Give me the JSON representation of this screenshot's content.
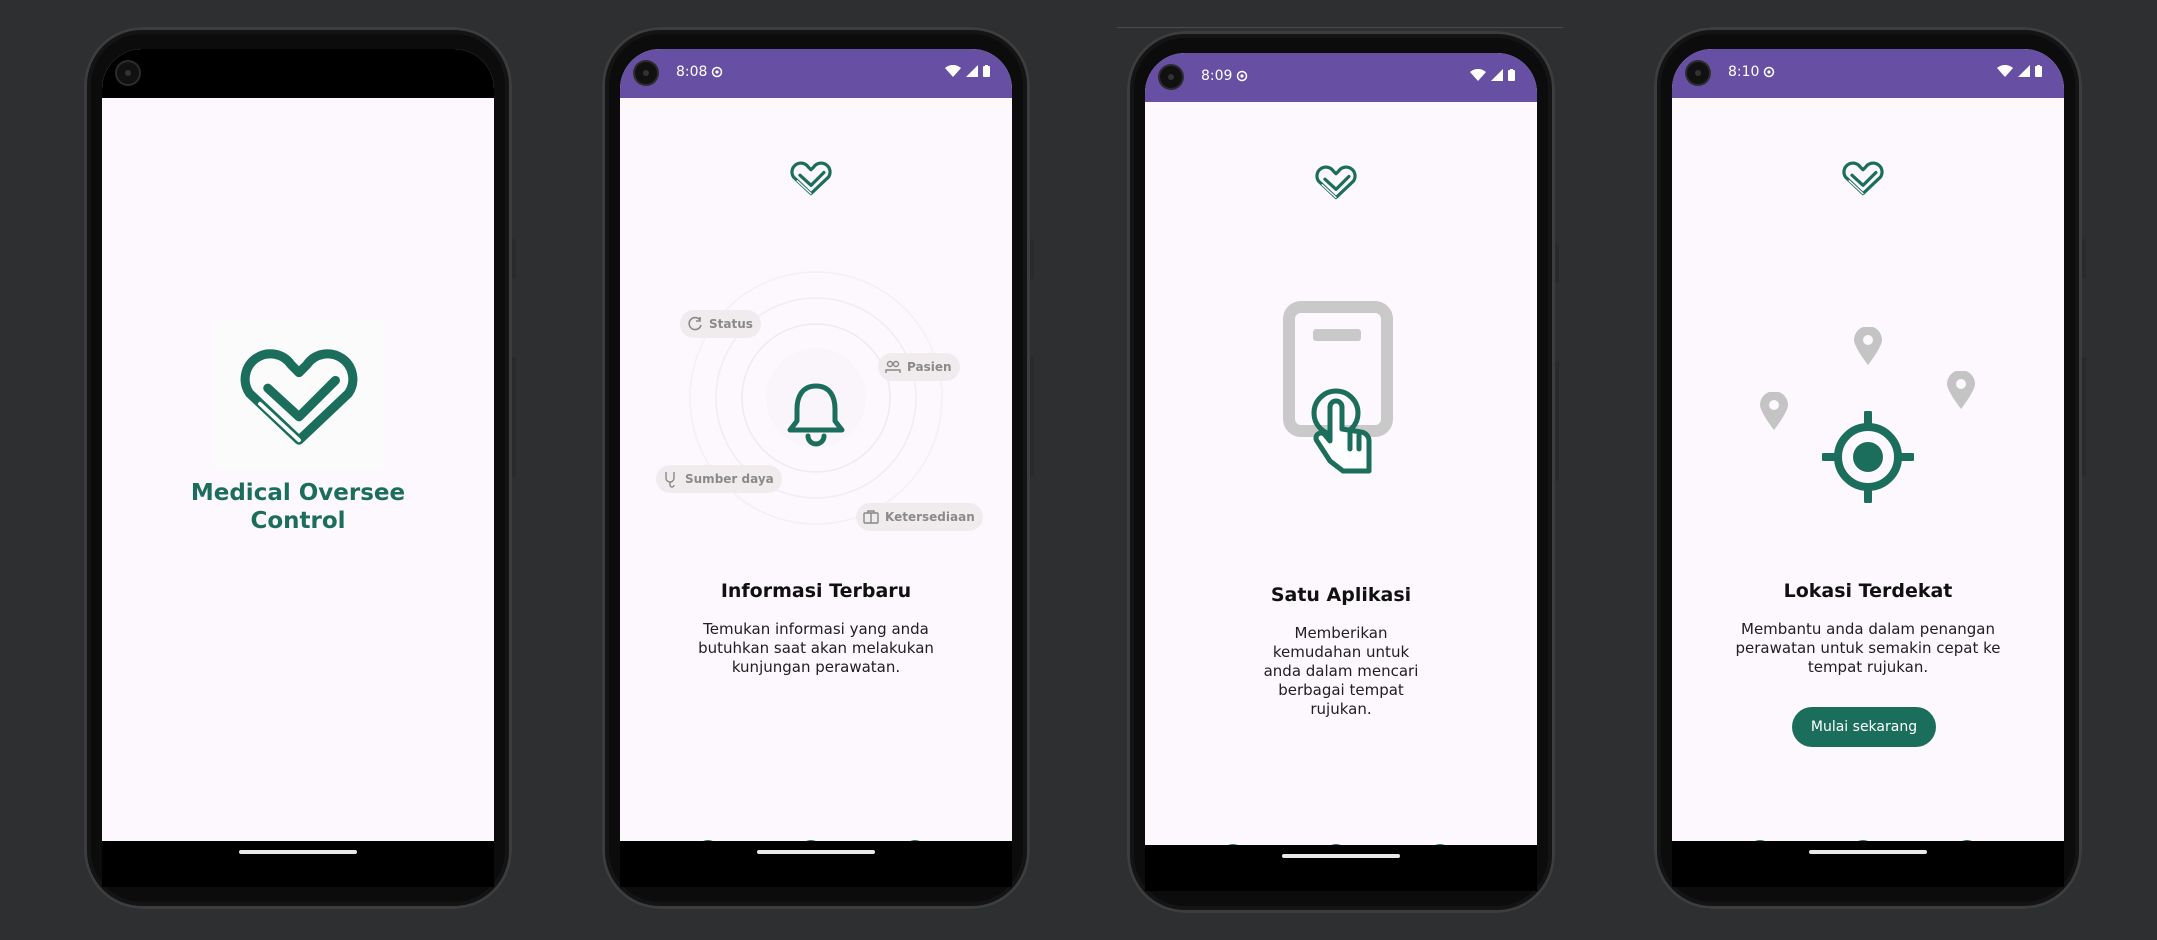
{
  "colors": {
    "brand": "#1c6e5c",
    "statusbar": "#6750a4",
    "background": "#2e2f30",
    "screen": "#fdf8fd"
  },
  "splash": {
    "app_name_line1": "Medical Oversee",
    "app_name_line2": "Control",
    "logo_icon": "heart-check-icon"
  },
  "screen1": {
    "time": "8:08",
    "chips": [
      "Status",
      "Pasien",
      "Sumber daya",
      "Ketersediaan"
    ],
    "title": "Informasi Terbaru",
    "description": [
      "Temukan informasi yang anda",
      "butuhkan saat akan melakukan",
      "kunjungan perawatan."
    ],
    "active_page": 1
  },
  "screen2": {
    "time": "8:09",
    "title": "Satu Aplikasi",
    "description": [
      "Memberikan",
      "kemudahan untuk",
      "anda dalam mencari",
      "berbagai tempat",
      "rujukan."
    ],
    "active_page": 2
  },
  "screen3": {
    "time": "8:10",
    "title": "Lokasi Terdekat",
    "description": [
      "Membantu anda dalam penangan",
      "perawatan untuk semakin cepat ke",
      "tempat rujukan."
    ],
    "button_label": "Mulai sekarang",
    "active_page": 3
  }
}
